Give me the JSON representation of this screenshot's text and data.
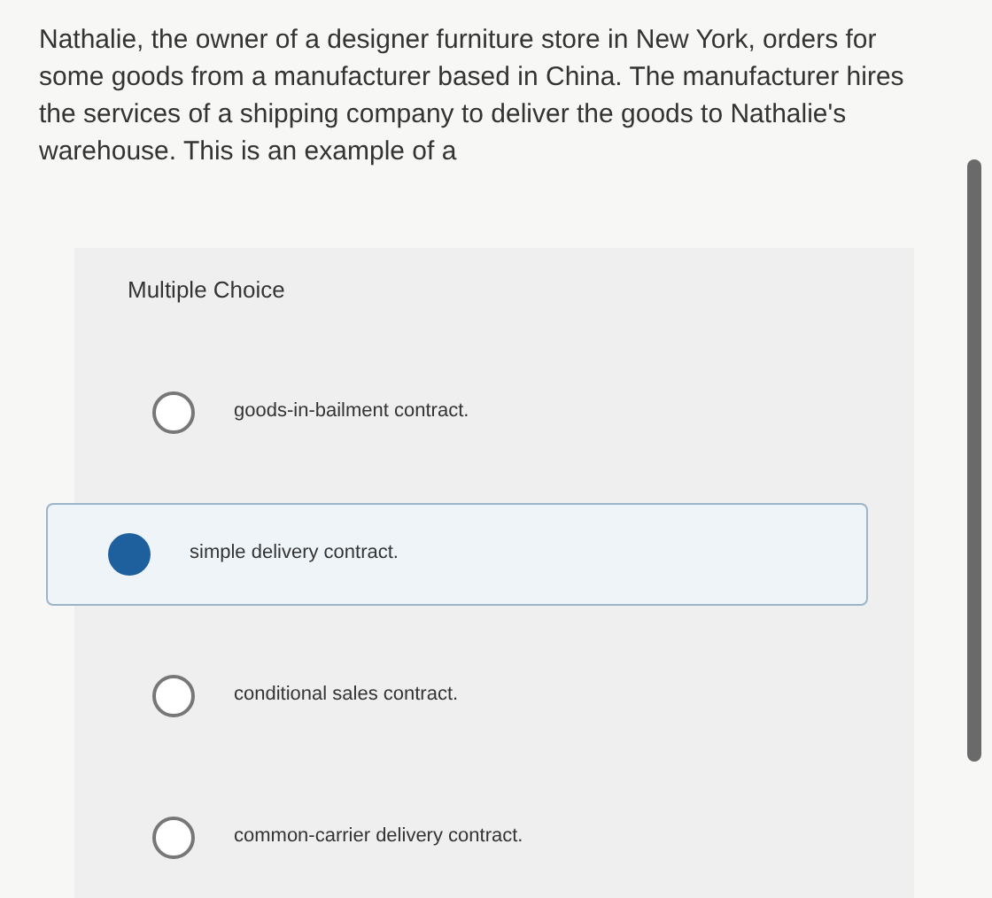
{
  "question": "Nathalie, the owner of a designer furniture store in New York, orders for some goods from a manufacturer based in China. The manufacturer hires the services of a shipping company to deliver the goods to Nathalie's warehouse. This is an example of a",
  "panel": {
    "label": "Multiple Choice"
  },
  "options": [
    {
      "text": "goods-in-bailment contract.",
      "selected": false
    },
    {
      "text": "simple delivery contract.",
      "selected": true
    },
    {
      "text": "conditional sales contract.",
      "selected": false
    },
    {
      "text": "common-carrier delivery contract.",
      "selected": false
    }
  ]
}
